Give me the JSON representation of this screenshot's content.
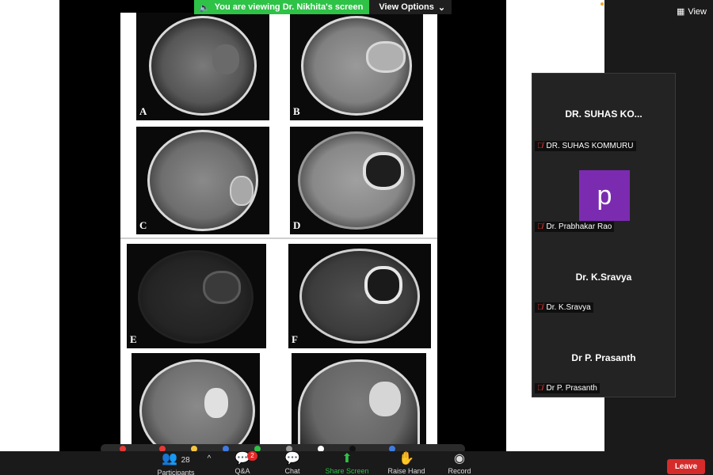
{
  "banner": {
    "viewing_text": "You are viewing Dr. Nikhita's screen",
    "view_options_label": "View Options"
  },
  "top_right": {
    "view_label": "View"
  },
  "slide": {
    "panels": [
      "A",
      "B",
      "C",
      "D",
      "E",
      "F"
    ]
  },
  "gallery": {
    "participants": [
      {
        "display_name": "DR. SUHAS KO...",
        "label": "DR. SUHAS KOMMURU",
        "avatar": ""
      },
      {
        "display_name": "",
        "label": "Dr. Prabhakar Rao",
        "avatar": "p"
      },
      {
        "display_name": "Dr. K.Sravya",
        "label": "Dr. K.Sravya",
        "avatar": ""
      },
      {
        "display_name": "Dr P. Prasanth",
        "label": "Dr P. Prasanth",
        "avatar": ""
      }
    ]
  },
  "toolbar": {
    "participants_label": "Participants",
    "participants_count": "28",
    "qa_label": "Q&A",
    "qa_badge": "2",
    "chat_label": "Chat",
    "share_label": "Share Screen",
    "raise_hand_label": "Raise Hand",
    "record_label": "Record",
    "leave_label": "Leave"
  },
  "colors": {
    "banner_green": "#2ec247",
    "avatar_purple": "#7b2bb0",
    "leave_red": "#d62b2b",
    "mic_muted_red": "#e53935"
  }
}
